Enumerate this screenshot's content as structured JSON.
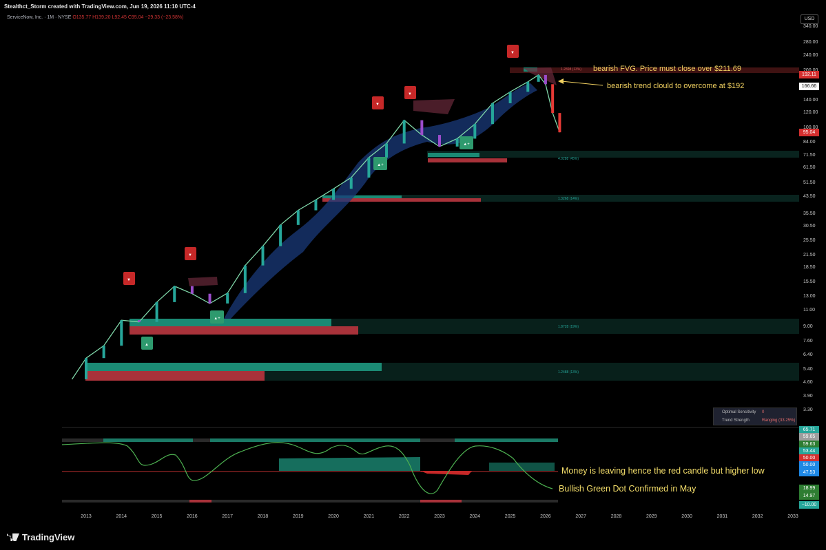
{
  "header": "Stealthct_Storm created with TradingView.com, Jun 19, 2026 11:10 UTC-4",
  "symbol_line": {
    "name": "ServiceNow, Inc. · 1M · NYSE",
    "ohlc": "O135.77  H139.20  L92.45  C95.04  −29.33 (−23.58%)"
  },
  "currency": "USD",
  "brand": "TradingView",
  "colors": {
    "bull": "#26a69a",
    "bear": "#d32f2f",
    "ribbon": "#2a4a8a",
    "annotation": "#f0d060"
  },
  "chart_data": {
    "type": "line",
    "price_axis": {
      "scale": "log",
      "ticks": [
        "340.00",
        "280.00",
        "240.00",
        "200.00",
        "166.66",
        "140.00",
        "120.00",
        "100.00",
        "84.00",
        "71.50",
        "61.50",
        "51.50",
        "43.50",
        "35.50",
        "30.50",
        "25.50",
        "21.50",
        "18.50",
        "15.50",
        "13.00",
        "11.00",
        "9.00",
        "7.60",
        "6.40",
        "5.40",
        "4.60",
        "3.90",
        "3.30"
      ],
      "tags": [
        {
          "label": "192.11",
          "color": "#d32f2f"
        },
        {
          "label": "166.66",
          "color": "#ffffff"
        },
        {
          "label": "95.04",
          "color": "#d32f2f"
        }
      ]
    },
    "x_axis": {
      "ticks": [
        "2013",
        "2014",
        "2015",
        "2016",
        "2017",
        "2018",
        "2019",
        "2020",
        "2021",
        "2022",
        "2023",
        "2024",
        "2025",
        "2026",
        "2027",
        "2028",
        "2029",
        "2030",
        "2031",
        "2032",
        "2033"
      ]
    },
    "close_series": {
      "x": [
        "2012.6",
        "2013.0",
        "2013.5",
        "2014.0",
        "2014.5",
        "2015.0",
        "2015.5",
        "2016.0",
        "2016.5",
        "2017.0",
        "2017.5",
        "2018.0",
        "2018.5",
        "2019.0",
        "2019.5",
        "2020.0",
        "2020.5",
        "2021.0",
        "2021.5",
        "2022.0",
        "2022.5",
        "2023.0",
        "2023.5",
        "2024.0",
        "2024.5",
        "2025.0",
        "2025.5",
        "2025.8",
        "2026.0",
        "2026.2",
        "2026.4"
      ],
      "y": [
        4.8,
        6.2,
        7.2,
        9.8,
        9.6,
        12.2,
        14.8,
        13.5,
        12.0,
        13.6,
        19.0,
        24.0,
        31.0,
        37.0,
        42.0,
        48.0,
        55.0,
        70.0,
        83.0,
        110.0,
        92.0,
        80.0,
        88.0,
        105.0,
        135.0,
        155.0,
        175.0,
        190.0,
        170.0,
        120.0,
        95.04
      ]
    },
    "zone_labels": [
      "1.2898 (13%)",
      "4.0288 (45%)",
      "1.3268 (14%)",
      "1.8728 (19%)",
      "1.2488 (13%)"
    ],
    "oscillator": {
      "tags": [
        {
          "label": "65.71",
          "color": "#26a69a"
        },
        {
          "label": "59.65",
          "color": "#9e9e9e"
        },
        {
          "label": "59.63",
          "color": "#2e7d32"
        },
        {
          "label": "53.44",
          "color": "#26a69a"
        },
        {
          "label": "50.00",
          "color": "#d32f2f"
        },
        {
          "label": "50.00",
          "color": "#1e88e5"
        },
        {
          "label": "47.53",
          "color": "#1e88e5"
        },
        {
          "label": "18.99",
          "color": "#2e7d32"
        },
        {
          "label": "14.97",
          "color": "#2e7d32"
        },
        {
          "label": "−10.00",
          "color": "#26a69a"
        }
      ]
    }
  },
  "annotations": {
    "fvg": "bearish FVG. Price must close over $211.69",
    "cloud": "bearish trend clould to overcome at $192",
    "money": "Money is leaving hence the red candle but higher low",
    "dot": "Bullish Green Dot Confirmed in May"
  },
  "info_table": {
    "row1_label": "Optimal Sensitivity",
    "row1_value": "0",
    "row2_label": "Trend Strength",
    "row2_value": "Ranging (33.25%)"
  }
}
